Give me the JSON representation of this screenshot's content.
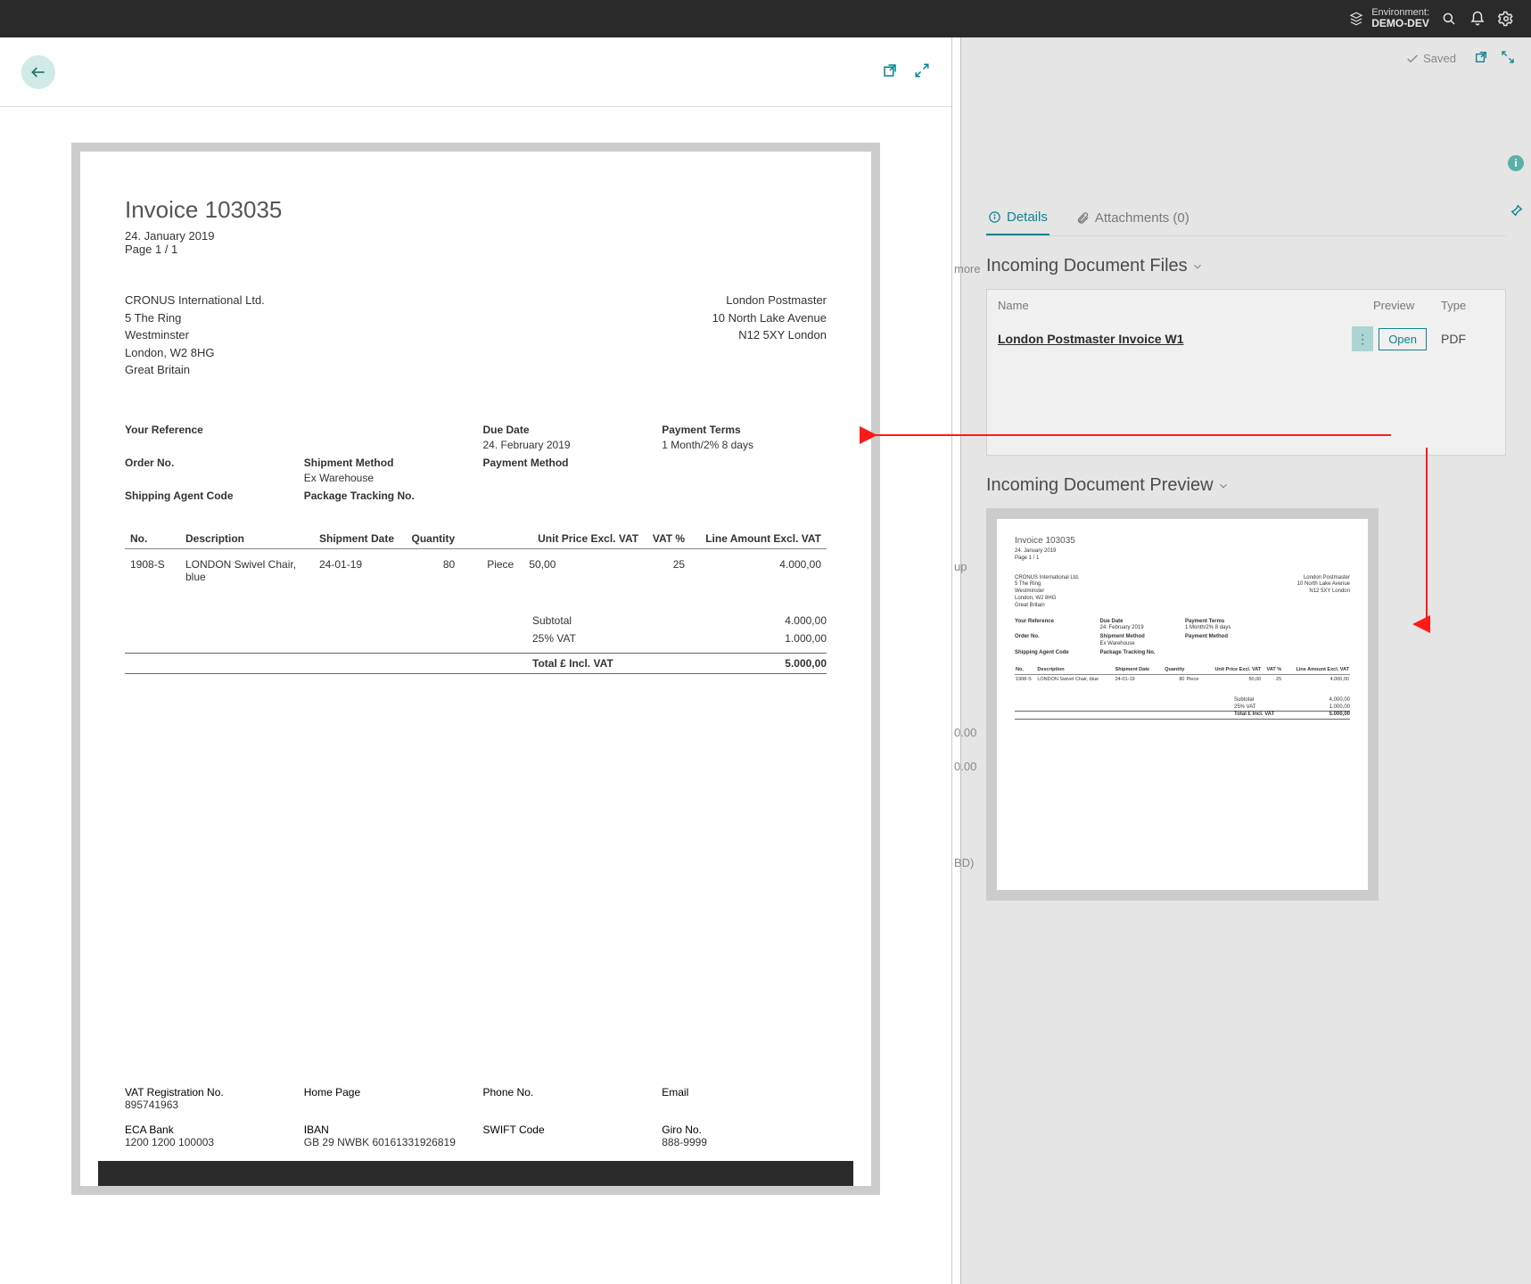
{
  "header": {
    "env_label": "Environment:",
    "env_name": "DEMO-DEV"
  },
  "rightPane": {
    "saved": "Saved",
    "tabs": {
      "details": "Details",
      "attachments": "Attachments (0)"
    },
    "filesSection": "Incoming Document Files",
    "filesCols": {
      "name": "Name",
      "preview": "Preview",
      "type": "Type"
    },
    "file": {
      "name": "London Postmaster Invoice W1",
      "open": "Open",
      "type": "PDF"
    },
    "previewSection": "Incoming Document Preview"
  },
  "ghost": {
    "more": "more",
    "up": "up",
    "v1": "0.00",
    "v2": "0.00",
    "v3": "BD)"
  },
  "invoice": {
    "title": "Invoice 103035",
    "date": "24. January 2019",
    "page": "Page  1 / 1",
    "sender": {
      "name": "CRONUS International Ltd.",
      "addr1": "5 The Ring",
      "addr2": "Westminster",
      "addr3": "London, W2 8HG",
      "addr4": "Great Britain"
    },
    "recipient": {
      "name": "London Postmaster",
      "addr1": "10 North Lake Avenue",
      "addr2": "N12 5XY London"
    },
    "meta": {
      "yourRefLbl": "Your Reference",
      "yourRef": "",
      "dueDateLbl": "Due Date",
      "dueDate": "24. February 2019",
      "payTermsLbl": "Payment Terms",
      "payTerms": "1 Month/2% 8 days",
      "orderNoLbl": "Order No.",
      "orderNo": "",
      "shipMethodLbl": "Shipment Method",
      "shipMethod": "Ex Warehouse",
      "payMethodLbl": "Payment Method",
      "payMethod": "",
      "shipAgentLbl": "Shipping Agent Code",
      "shipAgent": "",
      "pkgTrackLbl": "Package Tracking No.",
      "pkgTrack": ""
    },
    "cols": {
      "no": "No.",
      "desc": "Description",
      "shipDate": "Shipment Date",
      "qty": "Quantity",
      "uom": "",
      "unitPrice": "Unit Price Excl. VAT",
      "vatPct": "VAT %",
      "lineAmt": "Line Amount Excl. VAT"
    },
    "lines": [
      {
        "no": "1908-S",
        "desc": "LONDON Swivel Chair, blue",
        "shipDate": "24-01-19",
        "qty": "80",
        "uom": "Piece",
        "unitPrice": "50,00",
        "vatPct": "25",
        "lineAmt": "4.000,00"
      }
    ],
    "totals": {
      "subLbl": "Subtotal",
      "sub": "4.000,00",
      "vatLbl": "25% VAT",
      "vat": "1.000,00",
      "grandLbl": "Total £ Incl. VAT",
      "grand": "5.000,00"
    },
    "footer": {
      "vatRegLbl": "VAT Registration No.",
      "vatReg": "895741963",
      "homePageLbl": "Home Page",
      "homePage": "",
      "phoneLbl": "Phone No.",
      "phone": "",
      "emailLbl": "Email",
      "email": "",
      "bankLbl": "ECA Bank",
      "bank": "1200 1200 100003",
      "ibanLbl": "IBAN",
      "iban": "GB 29 NWBK 60161331926819",
      "swiftLbl": "SWIFT Code",
      "swift": "",
      "giroLbl": "Giro No.",
      "giro": "888-9999"
    }
  }
}
